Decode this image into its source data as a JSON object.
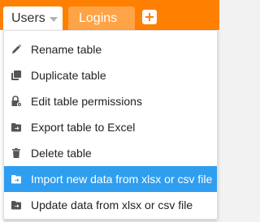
{
  "tabs": {
    "users_label": "Users",
    "logins_label": "Logins",
    "add_icon": "plus-square-icon"
  },
  "colors": {
    "brand": "#ff8000",
    "highlight": "#2f9ef0",
    "icon": "#555555"
  },
  "menu": {
    "items": [
      {
        "label": "Rename table",
        "icon": "pencil-icon"
      },
      {
        "label": "Duplicate table",
        "icon": "duplicate-icon"
      },
      {
        "label": "Edit table permissions",
        "icon": "lock-gear-icon"
      },
      {
        "label": "Export table to Excel",
        "icon": "export-folder-icon"
      },
      {
        "label": "Delete table",
        "icon": "trash-icon"
      },
      {
        "label": "Import new data from xlsx or csv file",
        "icon": "import-folder-icon",
        "active": true
      },
      {
        "label": "Update data from xlsx or csv file",
        "icon": "update-folder-icon"
      }
    ]
  }
}
